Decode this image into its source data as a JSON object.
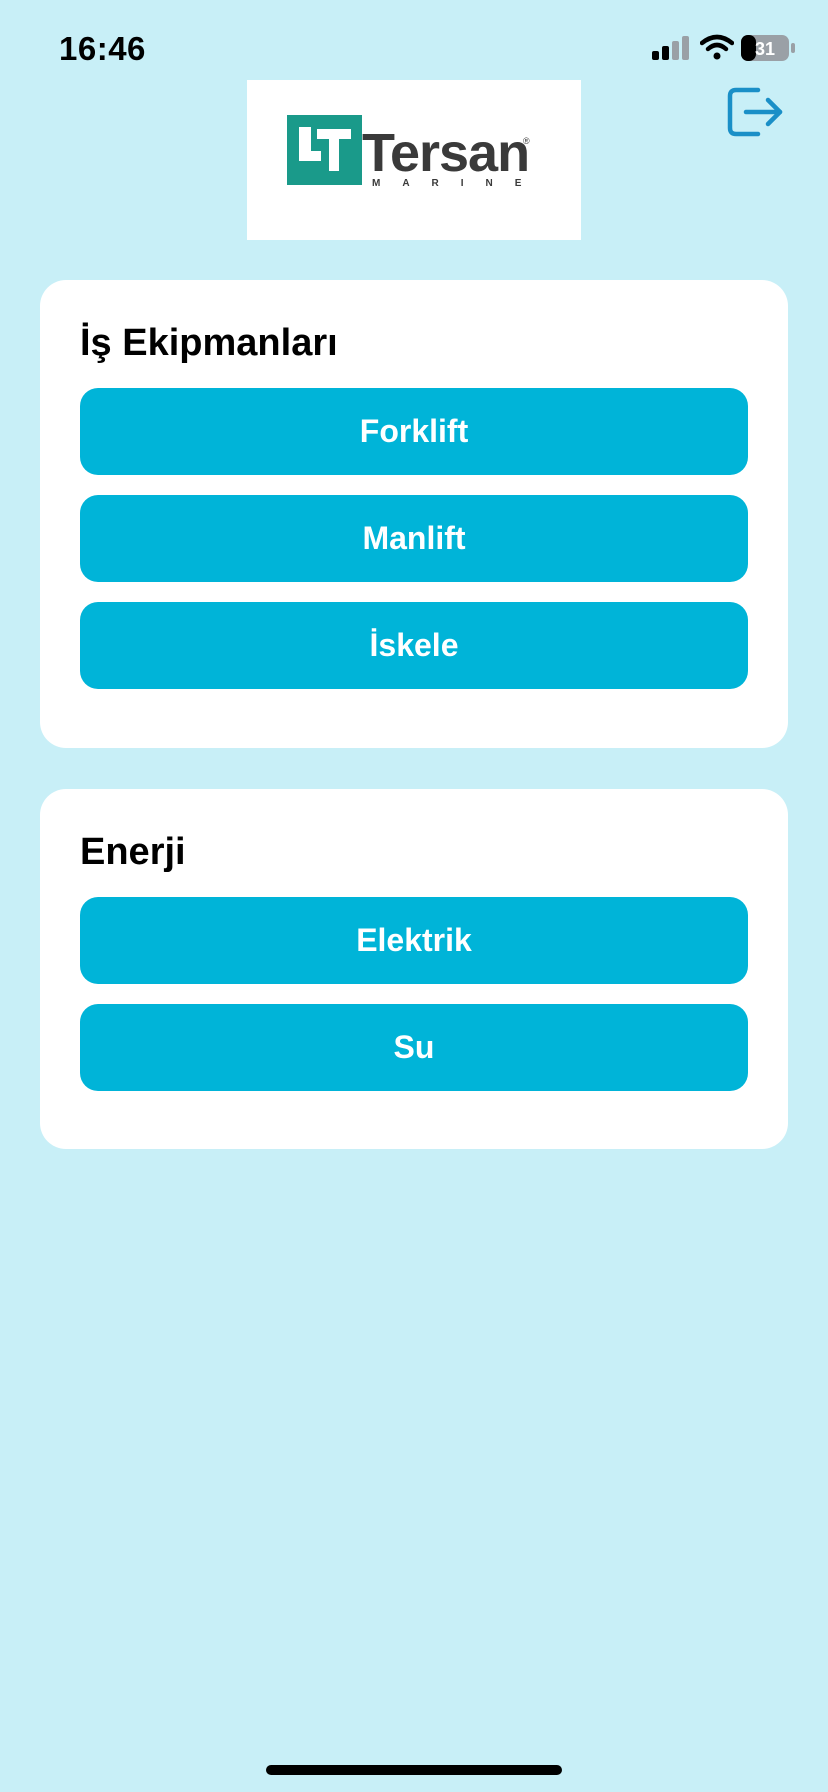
{
  "status_bar": {
    "time": "16:46",
    "battery": "31"
  },
  "logo": {
    "word": "Tersan",
    "sub": "MARINE",
    "reg": "®",
    "mark_color": "#1a9a8a"
  },
  "header": {
    "logout_icon": "logout-icon"
  },
  "sections": [
    {
      "title": "İş Ekipmanları",
      "buttons": [
        "Forklift",
        "Manlift",
        "İskele"
      ]
    },
    {
      "title": "Enerji",
      "buttons": [
        "Elektrik",
        "Su"
      ]
    }
  ],
  "colors": {
    "background": "#c8eff7",
    "button": "#00b4d8",
    "accent_icon": "#1a8fc7"
  }
}
